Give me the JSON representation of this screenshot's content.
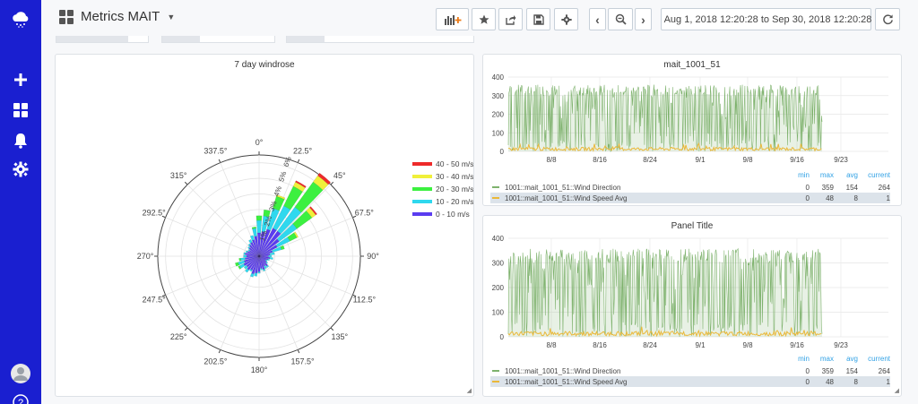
{
  "app": {
    "dashboard_title": "Metrics MAIT"
  },
  "sidebar": {
    "items": [
      {
        "name": "logo",
        "icon": "cloud-logo-icon"
      },
      {
        "name": "create",
        "icon": "plus-icon"
      },
      {
        "name": "dashboards",
        "icon": "dashboard-grid-icon"
      },
      {
        "name": "alerting",
        "icon": "bell-icon"
      },
      {
        "name": "configuration",
        "icon": "gear-icon"
      },
      {
        "name": "profile",
        "icon": "avatar-icon"
      },
      {
        "name": "help",
        "icon": "help-icon",
        "label": "?"
      }
    ]
  },
  "toolbar": {
    "buttons": [
      {
        "name": "add-panel",
        "icon": "bar-chart-add-icon"
      },
      {
        "name": "star",
        "icon": "star-icon"
      },
      {
        "name": "share",
        "icon": "share-icon"
      },
      {
        "name": "save",
        "icon": "save-icon"
      },
      {
        "name": "settings",
        "icon": "gear-icon"
      }
    ],
    "time_back_icon": "chevron-left-icon",
    "zoom_icon": "zoom-out-icon",
    "time_forward_icon": "chevron-right-icon",
    "time_range": "Aug 1, 2018 12:20:28 to Sep 30, 2018 12:20:28",
    "time_icon": "clock-icon",
    "refresh_icon": "refresh-icon"
  },
  "colors": {
    "sidebar": "#1a1fd0",
    "wind_direction": "#7eb26d",
    "wind_speed": "#eab839",
    "legend_header": "#33a2e5"
  },
  "windrose": {
    "title": "7 day windrose",
    "chart_data": {
      "type": "barpolar",
      "angle_labels": [
        "0°",
        "22.5°",
        "45°",
        "67.5°",
        "90°",
        "112.5°",
        "135°",
        "157.5°",
        "180°",
        "202.5°",
        "225°",
        "247.5°",
        "270°",
        "292.5°",
        "315°",
        "337.5°"
      ],
      "radial_tick_labels": [
        "1%",
        "2%",
        "3%",
        "4%",
        "5%",
        "6%"
      ],
      "legend": [
        {
          "label": "40 - 50 m/s",
          "color": "#ee2a2a"
        },
        {
          "label": "30 - 40 m/s",
          "color": "#f0f03a"
        },
        {
          "label": "20 - 30 m/s",
          "color": "#3cf040"
        },
        {
          "label": "10 - 20 m/s",
          "color": "#2fd8ee"
        },
        {
          "label": "0 - 10 m/s",
          "color": "#5a3cf0"
        }
      ],
      "bins": [
        {
          "dir": 0,
          "values": [
            1.5,
            0.8,
            0.3,
            0,
            0
          ]
        },
        {
          "dir": 10,
          "values": [
            1.6,
            1.0,
            0.4,
            0,
            0
          ]
        },
        {
          "dir": 20,
          "values": [
            1.8,
            1.4,
            0.8,
            0.1,
            0
          ]
        },
        {
          "dir": 30,
          "values": [
            2.0,
            1.6,
            1.4,
            0.3,
            0.1
          ]
        },
        {
          "dir": 40,
          "values": [
            2.0,
            1.9,
            2.0,
            0.5,
            0.2
          ]
        },
        {
          "dir": 50,
          "values": [
            1.6,
            1.4,
            1.2,
            0.3,
            0.1
          ]
        },
        {
          "dir": 60,
          "values": [
            1.3,
            0.9,
            0.5,
            0.1,
            0
          ]
        },
        {
          "dir": 70,
          "values": [
            0.9,
            0.6,
            0.2,
            0,
            0
          ]
        },
        {
          "dir": 80,
          "values": [
            0.7,
            0.3,
            0,
            0,
            0
          ]
        },
        {
          "dir": 90,
          "values": [
            0.6,
            0.2,
            0,
            0,
            0
          ]
        },
        {
          "dir": 100,
          "values": [
            0.7,
            0.2,
            0,
            0,
            0
          ]
        },
        {
          "dir": 110,
          "values": [
            0.6,
            0.1,
            0,
            0,
            0
          ]
        },
        {
          "dir": 120,
          "values": [
            0.5,
            0.1,
            0,
            0,
            0
          ]
        },
        {
          "dir": 130,
          "values": [
            0.6,
            0.1,
            0,
            0,
            0
          ]
        },
        {
          "dir": 140,
          "values": [
            0.8,
            0.1,
            0,
            0,
            0
          ]
        },
        {
          "dir": 150,
          "values": [
            0.7,
            0.2,
            0,
            0,
            0
          ]
        },
        {
          "dir": 160,
          "values": [
            0.9,
            0.1,
            0,
            0,
            0
          ]
        },
        {
          "dir": 170,
          "values": [
            0.8,
            0.1,
            0,
            0,
            0
          ]
        },
        {
          "dir": 180,
          "values": [
            1.0,
            0.1,
            0,
            0,
            0
          ]
        },
        {
          "dir": 190,
          "values": [
            1.1,
            0.2,
            0,
            0,
            0
          ]
        },
        {
          "dir": 200,
          "values": [
            1.2,
            0.2,
            0,
            0,
            0
          ]
        },
        {
          "dir": 210,
          "values": [
            1.0,
            0.1,
            0,
            0,
            0
          ]
        },
        {
          "dir": 220,
          "values": [
            1.1,
            0.2,
            0,
            0,
            0
          ]
        },
        {
          "dir": 230,
          "values": [
            1.0,
            0.2,
            0,
            0,
            0
          ]
        },
        {
          "dir": 240,
          "values": [
            1.1,
            0.3,
            0.1,
            0,
            0
          ]
        },
        {
          "dir": 250,
          "values": [
            1.0,
            0.4,
            0.2,
            0,
            0
          ]
        },
        {
          "dir": 260,
          "values": [
            0.9,
            0.3,
            0.1,
            0,
            0
          ]
        },
        {
          "dir": 270,
          "values": [
            0.8,
            0.2,
            0,
            0,
            0
          ]
        },
        {
          "dir": 280,
          "values": [
            0.9,
            0.1,
            0,
            0,
            0
          ]
        },
        {
          "dir": 290,
          "values": [
            0.8,
            0.1,
            0,
            0,
            0
          ]
        },
        {
          "dir": 300,
          "values": [
            0.7,
            0.1,
            0,
            0,
            0
          ]
        },
        {
          "dir": 310,
          "values": [
            0.8,
            0.1,
            0,
            0,
            0
          ]
        },
        {
          "dir": 320,
          "values": [
            0.9,
            0.1,
            0,
            0,
            0
          ]
        },
        {
          "dir": 330,
          "values": [
            1.0,
            0.2,
            0,
            0,
            0
          ]
        },
        {
          "dir": 340,
          "values": [
            1.1,
            0.3,
            0,
            0,
            0
          ]
        },
        {
          "dir": 350,
          "values": [
            1.3,
            0.5,
            0.1,
            0,
            0
          ]
        }
      ]
    }
  },
  "panels": [
    {
      "title": "mait_1001_51",
      "chart_data": {
        "type": "line",
        "x_tick_labels": [
          "8/8",
          "8/16",
          "8/24",
          "9/1",
          "9/8",
          "9/16",
          "9/23"
        ],
        "y_tick_labels": [
          "400",
          "300",
          "200",
          "100",
          "0"
        ],
        "ylim": [
          0,
          400
        ],
        "series": [
          {
            "name": "1001::mait_1001_51::Wind Direction",
            "color": "#7eb26d",
            "min": "0",
            "max": "359",
            "avg": "154",
            "current": "264"
          },
          {
            "name": "1001::mait_1001_51::Wind Speed Avg",
            "color": "#eab839",
            "min": "0",
            "max": "48",
            "avg": "8",
            "current": "1"
          }
        ]
      }
    },
    {
      "title": "Panel Title",
      "chart_data": {
        "type": "line",
        "x_tick_labels": [
          "8/8",
          "8/16",
          "8/24",
          "9/1",
          "9/8",
          "9/16",
          "9/23"
        ],
        "y_tick_labels": [
          "400",
          "300",
          "200",
          "100",
          "0"
        ],
        "ylim": [
          0,
          400
        ],
        "series": [
          {
            "name": "1001::mait_1001_51::Wind Direction",
            "color": "#7eb26d",
            "min": "0",
            "max": "359",
            "avg": "154",
            "current": "264"
          },
          {
            "name": "1001::mait_1001_51::Wind Speed Avg",
            "color": "#eab839",
            "min": "0",
            "max": "48",
            "avg": "8",
            "current": "1"
          }
        ]
      }
    }
  ],
  "legend_columns": [
    "min",
    "max",
    "avg",
    "current"
  ]
}
